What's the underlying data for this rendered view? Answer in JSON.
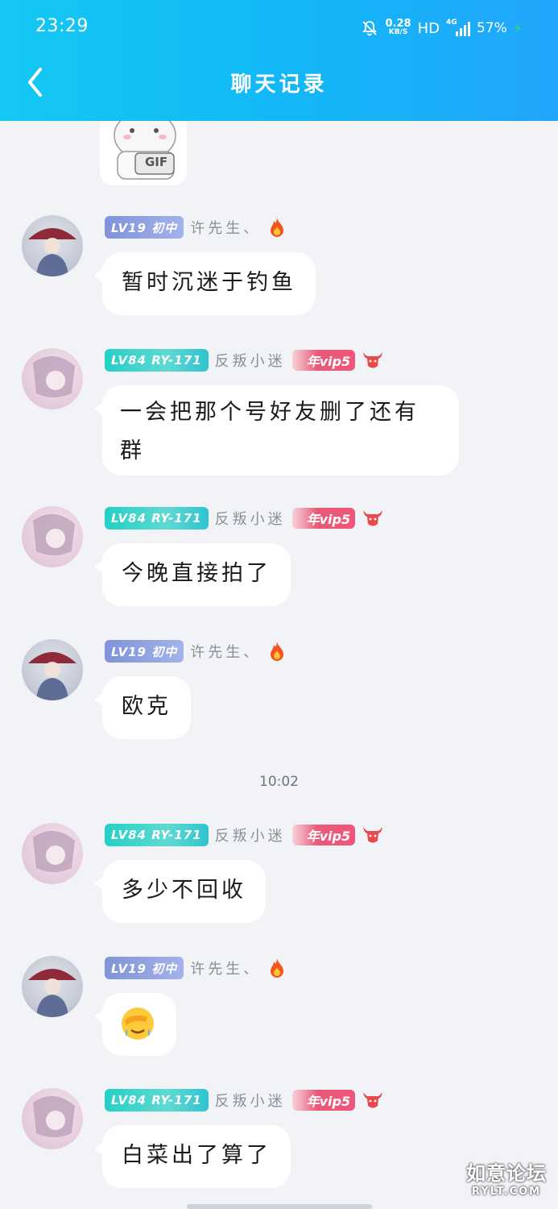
{
  "status_bar": {
    "time": "23:29",
    "net_speed": "0.28",
    "net_unit": "KB/S",
    "hd": "HD",
    "signal_type": "4G",
    "battery": "57%"
  },
  "header": {
    "title": "聊天记录",
    "back_icon": "chevron-left-icon"
  },
  "sticker": {
    "text": "GIF"
  },
  "messages": [
    {
      "badge": "LV19 初中",
      "nickname": "许先生、",
      "extra_badge": "fire-icon",
      "text": "暂时沉迷于钓鱼"
    },
    {
      "badge": "LV84 RY-171",
      "nickname": "反叛小迷",
      "vip": "年vip5",
      "extra_badge": "ox-icon",
      "text": "一会把那个号好友删了还有群"
    },
    {
      "badge": "LV84 RY-171",
      "nickname": "反叛小迷",
      "vip": "年vip5",
      "extra_badge": "ox-icon",
      "text": "今晚直接拍了"
    },
    {
      "badge": "LV19 初中",
      "nickname": "许先生、",
      "extra_badge": "fire-icon",
      "text": "欧克"
    },
    {
      "badge": "LV84 RY-171",
      "nickname": "反叛小迷",
      "vip": "年vip5",
      "extra_badge": "ox-icon",
      "text": "多少不回收"
    },
    {
      "badge": "LV19 初中",
      "nickname": "许先生、",
      "extra_badge": "fire-icon",
      "emoji": "facepalm-crying-emoji"
    },
    {
      "badge": "LV84 RY-171",
      "nickname": "反叛小迷",
      "vip": "年vip5",
      "extra_badge": "ox-icon",
      "text": "白菜出了算了"
    }
  ],
  "time_divider": "10:02",
  "watermark": {
    "line1": "如意论坛",
    "line2": "RYLT.COM"
  },
  "colors": {
    "header_start": "#14c8f4",
    "header_end": "#21a6fb",
    "background": "#f2f3f7",
    "bubble": "#ffffff"
  }
}
